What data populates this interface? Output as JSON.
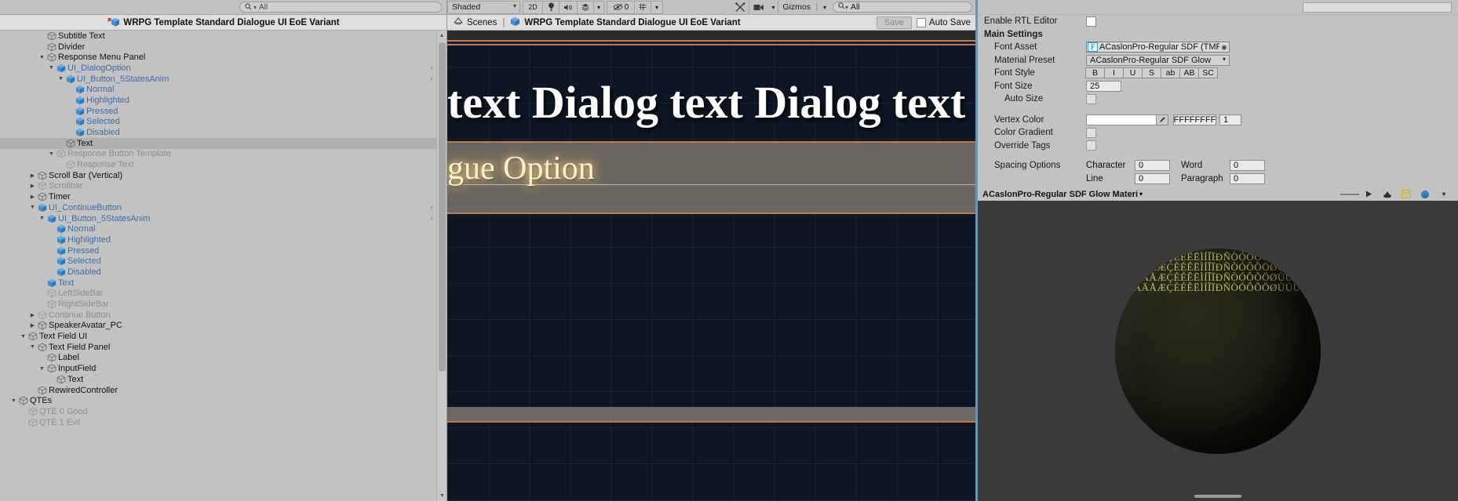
{
  "hierarchy": {
    "search_placeholder": "All",
    "title": "WRPG Template Standard Dialogue UI EoE Variant",
    "items": [
      {
        "label": "Subtitle Text",
        "depth": 4,
        "twisty": "",
        "style": "normal"
      },
      {
        "label": "Divider",
        "depth": 4,
        "twisty": "",
        "style": "normal"
      },
      {
        "label": "Response Menu Panel",
        "depth": 4,
        "twisty": "▼",
        "style": "normal"
      },
      {
        "label": "UI_DialogOption",
        "depth": 5,
        "twisty": "▼",
        "style": "prefab"
      },
      {
        "label": "UI_Button_5StatesAnim",
        "depth": 6,
        "twisty": "▼",
        "style": "prefab"
      },
      {
        "label": "Normal",
        "depth": 7,
        "twisty": "",
        "style": "prefab"
      },
      {
        "label": "Highlighted",
        "depth": 7,
        "twisty": "",
        "style": "prefab"
      },
      {
        "label": "Pressed",
        "depth": 7,
        "twisty": "",
        "style": "prefab"
      },
      {
        "label": "Selected",
        "depth": 7,
        "twisty": "",
        "style": "prefab"
      },
      {
        "label": "Disabled",
        "depth": 7,
        "twisty": "",
        "style": "prefab"
      },
      {
        "label": "Text",
        "depth": 6,
        "twisty": "",
        "style": "selected"
      },
      {
        "label": "Response Button Template",
        "depth": 5,
        "twisty": "▼",
        "style": "inactive"
      },
      {
        "label": "Response Text",
        "depth": 6,
        "twisty": "",
        "style": "inactive"
      },
      {
        "label": "Scroll Bar (Vertical)",
        "depth": 3,
        "twisty": "▶",
        "style": "normal"
      },
      {
        "label": "Scrollbar",
        "depth": 3,
        "twisty": "▶",
        "style": "inactive"
      },
      {
        "label": "Timer",
        "depth": 3,
        "twisty": "▶",
        "style": "normal"
      },
      {
        "label": "UI_ContinueButton",
        "depth": 3,
        "twisty": "▼",
        "style": "prefab"
      },
      {
        "label": "UI_Button_5StatesAnim",
        "depth": 4,
        "twisty": "▼",
        "style": "prefab"
      },
      {
        "label": "Normal",
        "depth": 5,
        "twisty": "",
        "style": "prefab"
      },
      {
        "label": "Highlighted",
        "depth": 5,
        "twisty": "",
        "style": "prefab"
      },
      {
        "label": "Pressed",
        "depth": 5,
        "twisty": "",
        "style": "prefab"
      },
      {
        "label": "Selected",
        "depth": 5,
        "twisty": "",
        "style": "prefab"
      },
      {
        "label": "Disabled",
        "depth": 5,
        "twisty": "",
        "style": "prefab"
      },
      {
        "label": "Text",
        "depth": 4,
        "twisty": "",
        "style": "prefab"
      },
      {
        "label": "LeftSideBar",
        "depth": 4,
        "twisty": "",
        "style": "inactive"
      },
      {
        "label": "RightSideBar",
        "depth": 4,
        "twisty": "",
        "style": "inactive"
      },
      {
        "label": "Continue Button",
        "depth": 3,
        "twisty": "▶",
        "style": "inactive"
      },
      {
        "label": "SpeakerAvatar_PC",
        "depth": 3,
        "twisty": "▶",
        "style": "normal"
      },
      {
        "label": "Text Field UI",
        "depth": 2,
        "twisty": "▼",
        "style": "normal"
      },
      {
        "label": "Text Field Panel",
        "depth": 3,
        "twisty": "▼",
        "style": "normal"
      },
      {
        "label": "Label",
        "depth": 4,
        "twisty": "",
        "style": "normal"
      },
      {
        "label": "InputField",
        "depth": 4,
        "twisty": "▼",
        "style": "normal"
      },
      {
        "label": "Text",
        "depth": 5,
        "twisty": "",
        "style": "normal"
      },
      {
        "label": "RewiredController",
        "depth": 3,
        "twisty": "",
        "style": "normal"
      },
      {
        "label": "QTEs",
        "depth": 1,
        "twisty": "▼",
        "style": "normal"
      },
      {
        "label": "QTE 0 Good",
        "depth": 2,
        "twisty": "",
        "style": "inactive"
      },
      {
        "label": "QTE 1 Evil",
        "depth": 2,
        "twisty": "",
        "style": "inactive"
      }
    ]
  },
  "scene_toolbar": {
    "draw_mode": "Shaded",
    "mode_2d": "2D",
    "lighting_icon": "lightbulb-icon",
    "audio_icon": "speaker-icon",
    "fx_icon": "effects-icon",
    "hidden_objects_icon": "eye-off-icon",
    "hidden_objects_count": "0",
    "grid_icon": "grid-icon",
    "scene_search_placeholder": "All",
    "tools_icon": "tools-icon",
    "camera_icon": "camera-icon",
    "gizmos_label": "Gizmos"
  },
  "scene_breadcrumb": {
    "scenes_label": "Scenes",
    "separator": "|",
    "prefab_name": "WRPG Template Standard Dialogue UI EoE Variant",
    "save_label": "Save",
    "autosave_label": "Auto Save",
    "autosave_checked": false
  },
  "scene_preview": {
    "line1": "text Dialog text Dialog text Dialog t",
    "line2": "gue Option",
    "bg_color": "#0c1624",
    "band_color": "#6b6660",
    "accent_color": "#c2794a",
    "text_color": "#ffffff",
    "glow_color": "#f6e7b4"
  },
  "inspector": {
    "enable_rtl_label": "Enable RTL Editor",
    "enable_rtl_checked": false,
    "main_settings_label": "Main Settings",
    "font_asset_label": "Font Asset",
    "font_asset_value": "ACaslonPro-Regular SDF (TMP_F",
    "font_asset_badge": "F",
    "material_preset_label": "Material Preset",
    "material_preset_value": "ACaslonPro-Regular SDF Glow",
    "font_style_label": "Font Style",
    "font_style_buttons": [
      "B",
      "I",
      "U",
      "S",
      "ab",
      "AB",
      "SC"
    ],
    "font_size_label": "Font Size",
    "font_size_value": "25",
    "auto_size_label": "Auto Size",
    "auto_size_checked": false,
    "vertex_color_label": "Vertex Color",
    "vertex_color_swatch": "#ffffff",
    "vertex_color_hex": "FFFFFFFF",
    "vertex_color_alpha": "1",
    "color_gradient_label": "Color Gradient",
    "color_gradient_checked": false,
    "override_tags_label": "Override Tags",
    "override_tags_checked": false,
    "spacing_options_label": "Spacing Options",
    "spacing_character_label": "Character",
    "spacing_character_value": "0",
    "spacing_word_label": "Word",
    "spacing_word_value": "0",
    "spacing_line_label": "Line",
    "spacing_line_value": "0",
    "spacing_paragraph_label": "Paragraph",
    "spacing_paragraph_value": "0"
  },
  "preview_panel": {
    "title": "ACaslonPro-Regular SDF Glow Materi",
    "glyph_sample": "ÁÂÃÄÅÆÇÈÉÊËÌÍÎÏÐÑÒÓÔÕÖØÙÚÛÜÝÞßàáâãäåæçèéêëìíîïðñòóôõöøùúûüýþÿĀāĂăĄąĆćĈĉĊċČčĎďĐđĒēĔĕĖėĘęĚěĜĝĞğĠġĢģĤĥĦħĨĩĪīĬĭĮįİıĲĳĴĵĶķĸĹĺĻļĽľĿŀŁłŃńŅņŇňŉŊŋŌōŎŏŐőŒœŔŕŖŗŘřŚśŜŝŞşŠšŢţŤťŦŧŨũŪūŬŭŮůŰűŲųŴŵŶŷŸŹźŻżŽž",
    "toolbar_icons": [
      "scale-slider",
      "play-icon",
      "lighting-icon",
      "ui-icon",
      "sphere-icon",
      "dropdown-icon"
    ]
  }
}
